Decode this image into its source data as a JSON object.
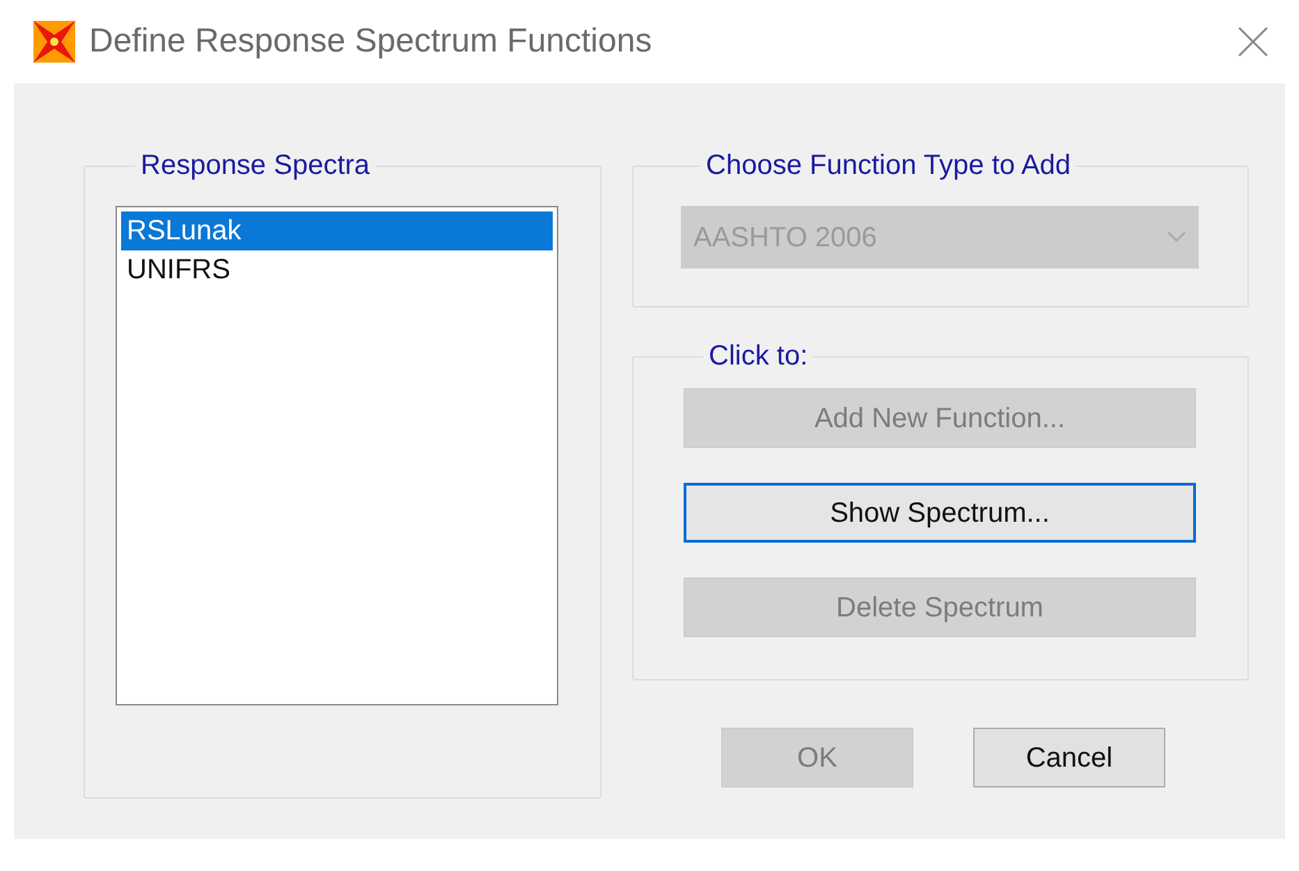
{
  "window": {
    "title": "Define Response Spectrum Functions"
  },
  "spectra": {
    "label": "Response Spectra",
    "items": [
      {
        "text": "RSLunak",
        "selected": true
      },
      {
        "text": "UNIFRS",
        "selected": false
      }
    ]
  },
  "function_type": {
    "label": "Choose  Function Type to Add",
    "value": "AASHTO 2006",
    "disabled": true
  },
  "actions": {
    "label": "Click to:",
    "buttons": [
      {
        "text": "Add New Function...",
        "disabled": true,
        "focused": false
      },
      {
        "text": "Show Spectrum...",
        "disabled": false,
        "focused": true
      },
      {
        "text": "Delete Spectrum",
        "disabled": true,
        "focused": false
      }
    ]
  },
  "footer_buttons": [
    {
      "text": "OK",
      "disabled": true
    },
    {
      "text": "Cancel",
      "disabled": false
    }
  ]
}
